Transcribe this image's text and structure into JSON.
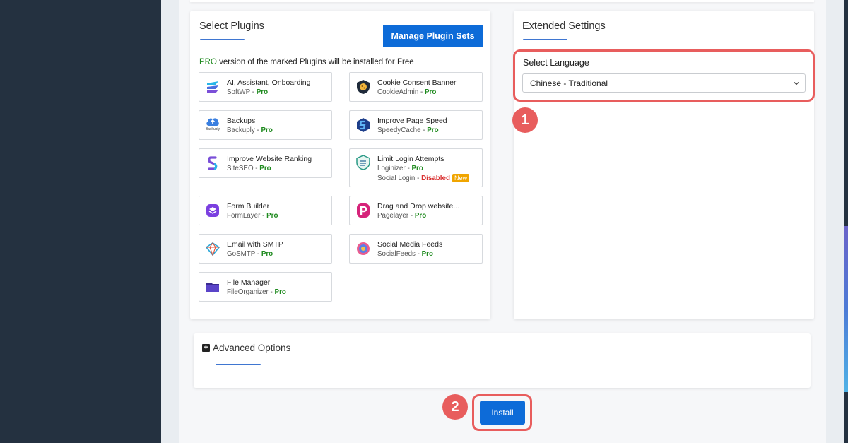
{
  "plugins_section": {
    "title": "Select Plugins",
    "manage_button": "Manage Plugin Sets",
    "pro_note_word": "PRO",
    "pro_note_rest": " version of the marked Plugins will be installed for Free",
    "items": [
      {
        "name": "AI, Assistant, Onboarding",
        "product": "SoftWP",
        "sep": " - ",
        "tag": "Pro",
        "icon": "softwp-icon"
      },
      {
        "name": "Cookie Consent Banner",
        "product": "CookieAdmin",
        "sep": " - ",
        "tag": "Pro",
        "icon": "cookie-shield-icon"
      },
      {
        "name": "Backups",
        "product": "Backuply",
        "sep": " - ",
        "tag": "Pro",
        "icon": "cloud-upload-icon",
        "icon_caption": "Backuply"
      },
      {
        "name": "Improve Page Speed",
        "product": "SpeedyCache",
        "sep": " - ",
        "tag": "Pro",
        "icon": "speedycache-icon"
      },
      {
        "name": "Improve Website Ranking",
        "product": "SiteSEO",
        "sep": " - ",
        "tag": "Pro",
        "icon": "siteseo-icon"
      },
      {
        "name": "Limit Login Attempts",
        "product": "Loginizer",
        "sep": " - ",
        "tag": "Pro",
        "icon": "loginizer-icon",
        "extra_product": "Social Login",
        "extra_sep": " - ",
        "extra_status": "Disabled",
        "extra_badge": "New"
      },
      {
        "name": "Form Builder",
        "product": "FormLayer",
        "sep": " - ",
        "tag": "Pro",
        "icon": "formlayer-icon"
      },
      {
        "name": "Drag and Drop website...",
        "product": "Pagelayer",
        "sep": " - ",
        "tag": "Pro",
        "icon": "pagelayer-icon"
      },
      {
        "name": "Email with SMTP",
        "product": "GoSMTP",
        "sep": " - ",
        "tag": "Pro",
        "icon": "gosmtp-icon"
      },
      {
        "name": "Social Media Feeds",
        "product": "SocialFeeds",
        "sep": " - ",
        "tag": "Pro",
        "icon": "socialfeeds-icon"
      },
      {
        "name": "File Manager",
        "product": "FileOrganizer",
        "sep": " - ",
        "tag": "Pro",
        "icon": "folder-icon"
      }
    ]
  },
  "extended_section": {
    "title": "Extended Settings",
    "language_label": "Select Language",
    "language_value": "Chinese - Traditional"
  },
  "advanced": {
    "title": "Advanced Options"
  },
  "install_button": "Install",
  "steps": {
    "one": "1",
    "two": "2"
  },
  "colors": {
    "accent": "#0d6bd8",
    "highlight": "#e85d5d",
    "pro": "#1e8a1e",
    "disabled": "#d93030",
    "new_badge": "#f0a500",
    "sidebar": "#243140"
  }
}
